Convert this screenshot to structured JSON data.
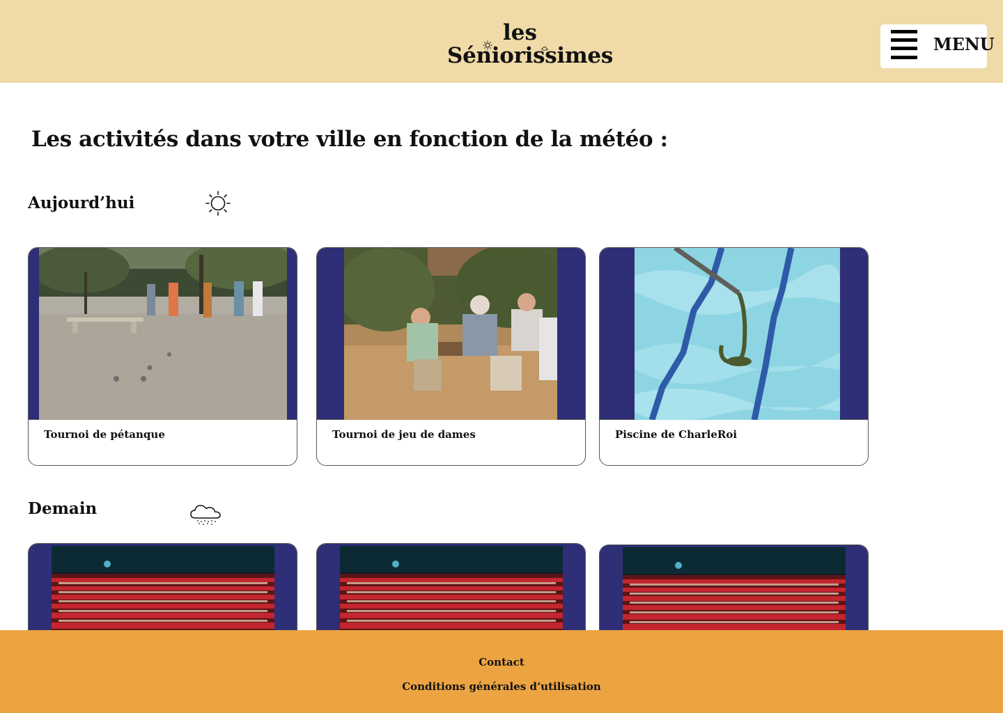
{
  "header": {
    "logo_top": "les",
    "logo_bottom": "Séniorissimes",
    "menu_label": "MENU"
  },
  "main": {
    "title": "Les activités dans votre ville en fonction de la météo :",
    "sections": [
      {
        "label": "Aujourd’hui",
        "weather_icon": "sun-icon",
        "activities": [
          {
            "title": "Tournoi de pétanque"
          },
          {
            "title": "Tournoi de jeu de dames"
          },
          {
            "title": "Piscine de CharleRoi"
          }
        ]
      },
      {
        "label": "Demain",
        "weather_icon": "rain-cloud-icon",
        "activities": [
          {
            "title": ""
          },
          {
            "title": ""
          },
          {
            "title": ""
          }
        ]
      }
    ]
  },
  "footer": {
    "links": [
      "Contact",
      "Conditions générales d’utilisation"
    ]
  },
  "colors": {
    "header_bg": "#f0dba8",
    "footer_bg": "#eca442",
    "card_frame": "#2e2f77",
    "text": "#111111"
  }
}
